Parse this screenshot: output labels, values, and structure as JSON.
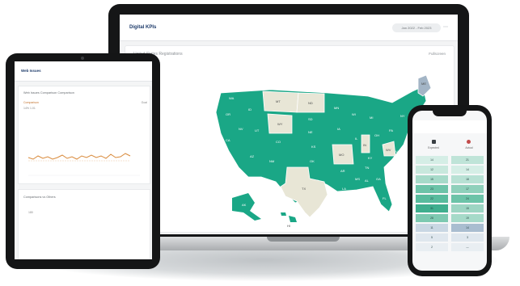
{
  "laptop": {
    "title": "Digital KPIs",
    "date_range": "Jan 2022 - Feb 2023",
    "menu_icon": "more-icon",
    "map_card": {
      "title": "United States Registrations",
      "link": "Fullscreen"
    },
    "map_labels": {
      "WA": "WA",
      "OR": "OR",
      "CA": "CA",
      "ID": "ID",
      "NV": "NV",
      "AZ": "AZ",
      "UT": "UT",
      "MT": "MT",
      "WY": "WY",
      "CO": "CO",
      "NM": "NM",
      "ND": "ND",
      "SD": "SD",
      "NE": "NE",
      "KS": "KS",
      "OK": "OK",
      "TX": "TX",
      "MN": "MN",
      "IA": "IA",
      "MO": "MO",
      "AR": "AR",
      "LA": "LA",
      "WI": "WI",
      "IL": "IL",
      "MI": "MI",
      "IN": "IN",
      "OH": "OH",
      "KY": "KY",
      "TN": "TN",
      "MS": "MS",
      "AL": "AL",
      "GA": "GA",
      "FL": "FL",
      "SC": "SC",
      "NC": "NC",
      "VA": "VA",
      "WV": "WV",
      "PA": "PA",
      "NY": "NY",
      "ME": "ME",
      "AK": "AK",
      "HI": "HI"
    },
    "colors": {
      "teal": "#1aa786",
      "beige": "#e8e6d6",
      "blue": "#a3b5c6"
    }
  },
  "tablet": {
    "title": "Web Issues",
    "card1_title": "Web Issues Comparison Comparison",
    "legend_a": "Comparison",
    "legend_a2": "14%  1.01",
    "legend_c": "Goal",
    "legend_c2": "4%",
    "card2_title": "Comparisons vs Others",
    "card2_val": "180",
    "line_color": "#d98a3b"
  },
  "phone": {
    "col_left": "Expected",
    "col_right": "Actual",
    "rows": [
      [
        "14",
        "21"
      ],
      [
        "12",
        "14"
      ],
      [
        "15",
        "18"
      ],
      [
        "23",
        "17"
      ],
      [
        "22",
        "24"
      ],
      [
        "31",
        "15"
      ],
      [
        "28",
        "19"
      ],
      [
        "11",
        "14"
      ],
      [
        "5",
        "3"
      ],
      [
        "2",
        "—"
      ]
    ]
  }
}
